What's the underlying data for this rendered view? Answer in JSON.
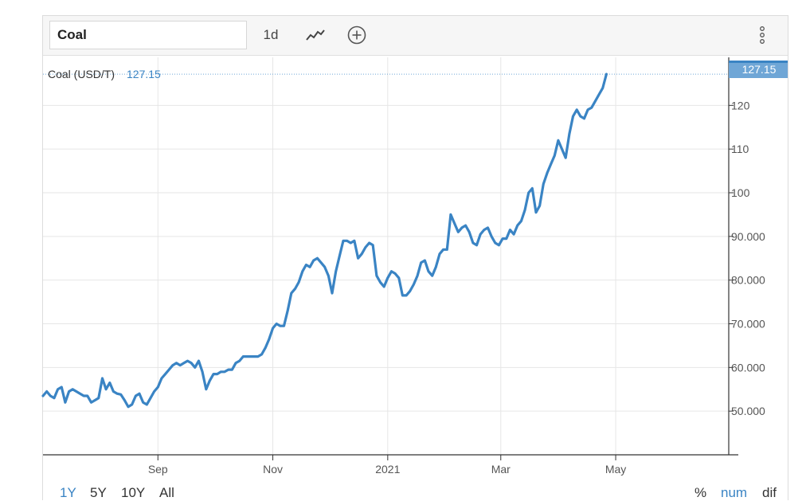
{
  "toolbar": {
    "search_value": "Coal",
    "interval_label": "1d"
  },
  "legend": {
    "series_label": "Coal (USD/T)",
    "last_value": "127.15"
  },
  "last_price_badge": "127.15",
  "range_buttons": [
    "1Y",
    "5Y",
    "10Y",
    "All"
  ],
  "active_range": "1Y",
  "mode_buttons": [
    "%",
    "num",
    "dif"
  ],
  "active_mode": "num",
  "colors": {
    "line": "#3a84c4",
    "badge": "#6fa6d6",
    "grid": "#e6e6e6"
  },
  "chart_data": {
    "type": "line",
    "title": "",
    "xlabel": "",
    "ylabel": "",
    "x_tick_labels": [
      "Sep",
      "Nov",
      "2021",
      "Mar",
      "May"
    ],
    "x_tick_positions_day": [
      62,
      124,
      186,
      247,
      309
    ],
    "y_ticks": [
      50,
      60,
      70,
      80,
      90,
      100,
      110,
      120
    ],
    "y_tick_labels": [
      "50.000",
      "60.000",
      "70.000",
      "80.000",
      "90.000",
      "100",
      "110",
      "120"
    ],
    "ylim": [
      40,
      131
    ],
    "xlim_day": [
      0,
      370
    ],
    "grid": true,
    "series": [
      {
        "name": "Coal (USD/T)",
        "x_day": [
          0,
          2,
          4,
          6,
          8,
          10,
          12,
          14,
          16,
          18,
          20,
          22,
          24,
          26,
          28,
          30,
          32,
          34,
          36,
          38,
          40,
          42,
          44,
          46,
          48,
          50,
          52,
          54,
          56,
          58,
          60,
          62,
          64,
          66,
          68,
          70,
          72,
          74,
          76,
          78,
          80,
          82,
          84,
          86,
          88,
          90,
          92,
          94,
          96,
          98,
          100,
          102,
          104,
          106,
          108,
          110,
          112,
          114,
          116,
          118,
          120,
          122,
          124,
          126,
          128,
          130,
          132,
          134,
          136,
          138,
          140,
          142,
          144,
          146,
          148,
          150,
          152,
          154,
          156,
          158,
          160,
          162,
          164,
          166,
          168,
          170,
          172,
          174,
          176,
          178,
          180,
          182,
          184,
          186,
          188,
          190,
          192,
          194,
          196,
          198,
          200,
          202,
          204,
          206,
          208,
          210,
          212,
          214,
          216,
          218,
          220,
          222,
          224,
          226,
          228,
          230,
          232,
          234,
          236,
          238,
          240,
          242,
          244,
          246,
          248,
          250,
          252,
          254,
          256,
          258,
          260,
          262,
          264,
          266,
          268,
          270,
          272,
          274,
          276,
          278,
          280,
          282,
          284,
          286,
          288,
          290,
          292,
          294,
          296,
          298,
          300,
          302,
          304,
          306,
          308,
          310,
          312,
          314,
          316,
          318,
          320,
          322,
          324,
          326,
          328,
          330,
          332,
          334,
          336,
          338,
          340,
          342,
          344,
          346,
          348,
          350,
          352,
          354,
          356,
          358,
          360,
          362,
          364,
          366
        ],
        "values": [
          53.5,
          54.5,
          53.5,
          53,
          55,
          55.5,
          52,
          54.5,
          55,
          54.5,
          54,
          53.5,
          53.5,
          52,
          52.5,
          53,
          57.5,
          55,
          56.5,
          54.5,
          54,
          53.8,
          52.5,
          51,
          51.5,
          53.5,
          54,
          52,
          51.5,
          53,
          54.5,
          55.5,
          57.5,
          58.5,
          59.5,
          60.5,
          61,
          60.5,
          61,
          61.5,
          61,
          60,
          61.5,
          59,
          55,
          57,
          58.5,
          58.5,
          59,
          59,
          59.5,
          59.5,
          61,
          61.5,
          62.5,
          62.5,
          62.5,
          62.5,
          62.5,
          63,
          64.5,
          66.5,
          69,
          70,
          69.5,
          69.5,
          73,
          77,
          78,
          79.5,
          82,
          83.5,
          83,
          84.5,
          85,
          84,
          83,
          81,
          77,
          82,
          85.5,
          89,
          89,
          88.5,
          89,
          85,
          86,
          87.5,
          88.5,
          88,
          81,
          79.5,
          78.5,
          80.5,
          82,
          81.5,
          80.5,
          76.5,
          76.5,
          77.5,
          79,
          81,
          84,
          84.5,
          82,
          81,
          83,
          86,
          87,
          87,
          95,
          93,
          91,
          92,
          92.5,
          91,
          88.5,
          88,
          90.5,
          91.5,
          92,
          90,
          88.5,
          88,
          89.5,
          89.5,
          91.5,
          90.5,
          92.5,
          93.5,
          96,
          100,
          101,
          95.5,
          97,
          102,
          104.5,
          106.5,
          108.5,
          112,
          110,
          108,
          113.5,
          117.5,
          119,
          117.5,
          117,
          119,
          119.5,
          121,
          122.5,
          124,
          127.15
        ]
      }
    ]
  }
}
